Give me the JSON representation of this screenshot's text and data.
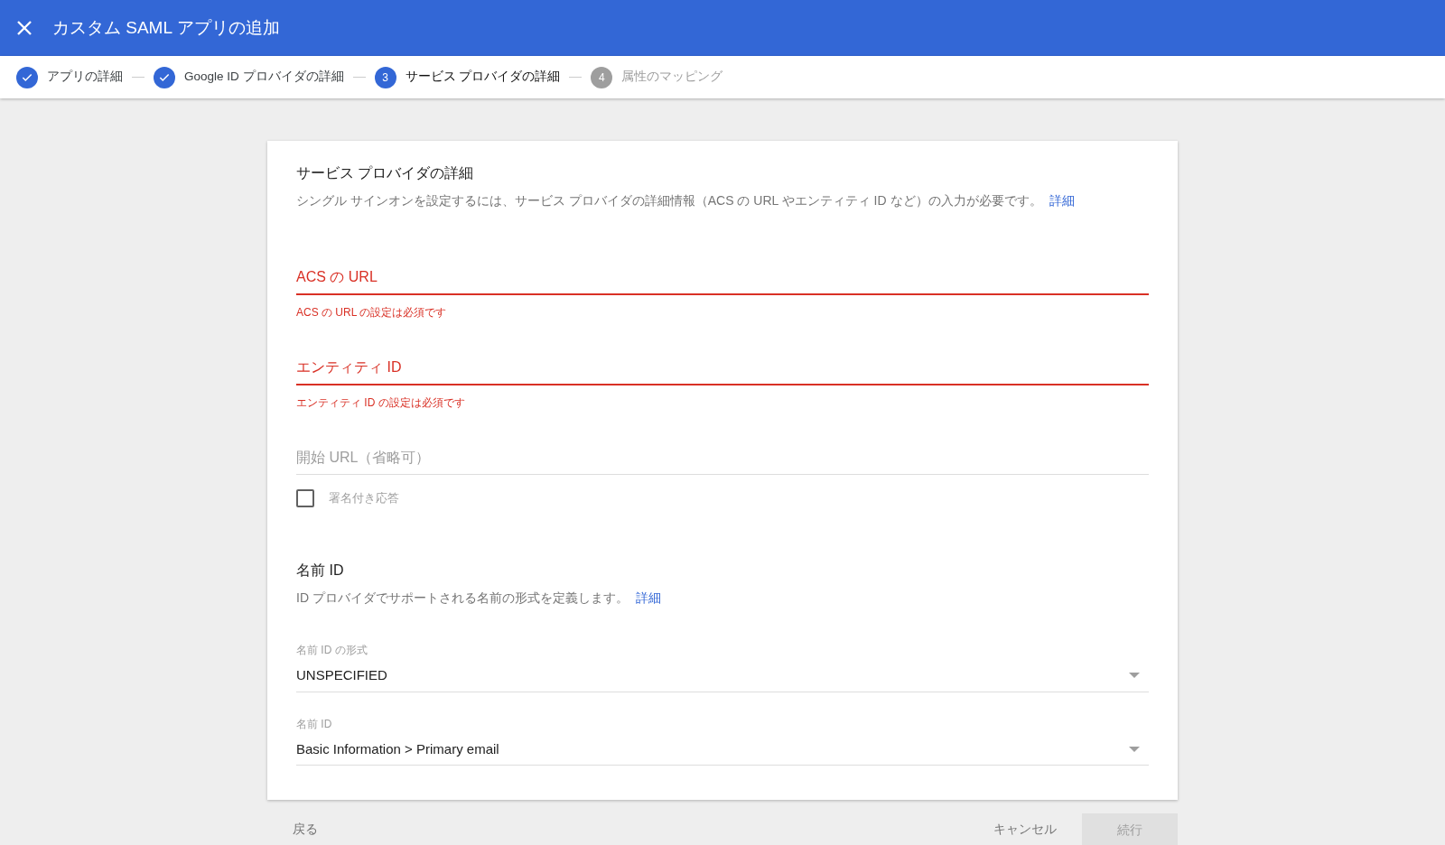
{
  "header": {
    "title": "カスタム SAML アプリの追加"
  },
  "steps": [
    {
      "label": "アプリの詳細",
      "completed": true,
      "selected": false
    },
    {
      "label": "Google ID プロバイダの詳細",
      "completed": true,
      "selected": false
    },
    {
      "number": "3",
      "label": "サービス プロバイダの詳細",
      "completed": false,
      "selected": true
    },
    {
      "number": "4",
      "label": "属性のマッピング",
      "completed": false,
      "selected": false
    }
  ],
  "card": {
    "title": "サービス プロバイダの詳細",
    "description": "シングル サインオンを設定するには、サービス プロバイダの詳細情報（ACS の URL やエンティティ ID など）の入力が必要です。",
    "link": "詳細",
    "fields": [
      {
        "placeholder": "ACS の URL",
        "error": "ACS の URL の設定は必須です"
      },
      {
        "placeholder": "エンティティ ID",
        "error": "エンティティ ID の設定は必須です"
      },
      {
        "placeholder": "開始 URL（省略可）"
      }
    ],
    "checkbox": {
      "label": "署名付き応答",
      "checked": false
    },
    "name_id": {
      "title": "名前 ID",
      "description": "ID プロバイダでサポートされる名前の形式を定義します。",
      "link": "詳細",
      "selects": [
        {
          "label": "名前 ID の形式",
          "value": "UNSPECIFIED"
        },
        {
          "label": "名前 ID",
          "value": "Basic Information > Primary email"
        }
      ]
    }
  },
  "footer": {
    "back": "戻る",
    "cancel": "キャンセル",
    "continue": {
      "label": "続行",
      "disabled": true
    }
  }
}
